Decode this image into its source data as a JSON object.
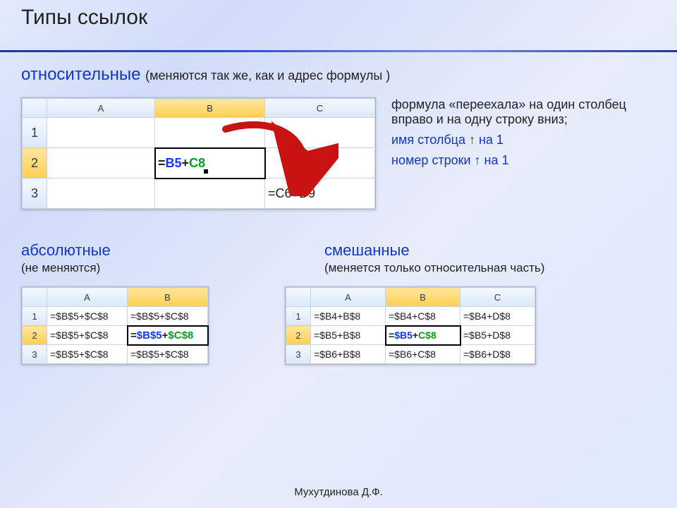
{
  "title": "Типы ссылок",
  "relative": {
    "heading": "относительные",
    "tail": "(меняются так же, как и адрес формулы )",
    "note1": "формула «переехала» на один столбец вправо и на одну строку вниз;",
    "note2": "имя столбца ↑ на 1",
    "note3": "номер строки ↑ на 1"
  },
  "absolute": {
    "heading": "абсолютные",
    "sub": "(не меняются)"
  },
  "mixed": {
    "heading": "смешанные",
    "sub": "(меняется только относительная часть)"
  },
  "sheet_rel": {
    "cols": [
      "A",
      "B",
      "C"
    ],
    "rows": [
      "1",
      "2",
      "3"
    ],
    "b2_eq": "=",
    "b2_a": "B5",
    "b2_plus": "+",
    "b2_b": "C8",
    "c3": "=C6+D9"
  },
  "sheet_abs": {
    "cols": [
      "A",
      "B"
    ],
    "rows": [
      "1",
      "2",
      "3"
    ],
    "a1": "=$B$5+$C$8",
    "b1": "=$B$5+$C$8",
    "a2": "=$B$5+$C$8",
    "b2_eq": "=",
    "b2_a": "$B$5",
    "b2_plus": "+",
    "b2_b": "$C$8",
    "a3": "=$B$5+$C$8",
    "b3": "=$B$5+$C$8"
  },
  "sheet_mix": {
    "cols": [
      "A",
      "B",
      "C"
    ],
    "rows": [
      "1",
      "2",
      "3"
    ],
    "a1": "=$B4+B$8",
    "b1": "=$B4+C$8",
    "c1": "=$B4+D$8",
    "a2": "=$B5+B$8",
    "b2_eq": "=",
    "b2_a": "$B5",
    "b2_plus": "+",
    "b2_b": "C$8",
    "c2": "=$B5+D$8",
    "a3": "=$B6+B$8",
    "b3": "=$B6+C$8",
    "c3": "=$B6+D$8"
  },
  "footer": "Мухутдинова Д.Ф."
}
